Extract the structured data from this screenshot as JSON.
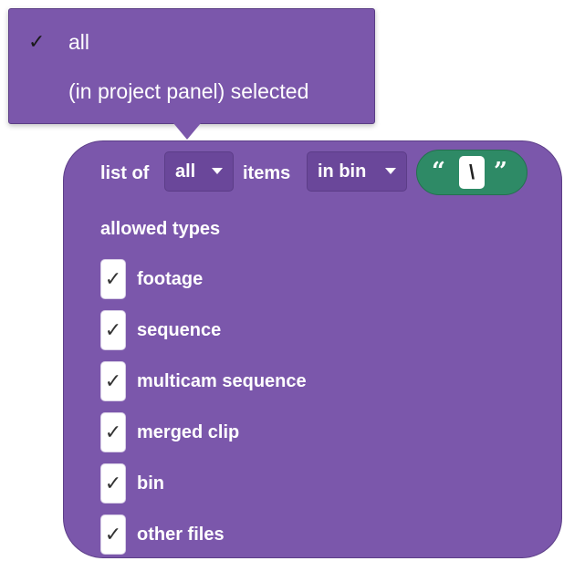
{
  "dropdown_menu": {
    "items": [
      {
        "label": "all",
        "checkmark": "✓",
        "selected": true
      },
      {
        "label": "(in project panel) selected",
        "checkmark": "",
        "selected": false
      }
    ]
  },
  "block": {
    "list_of_label": "list of",
    "scope_dropdown_value": "all",
    "items_label": "items",
    "location_dropdown_value": "in bin",
    "text_block": {
      "open_quote": "“",
      "value": "\\",
      "close_quote": "”"
    },
    "allowed_types_title": "allowed types",
    "checkboxes": [
      {
        "label": "footage",
        "checked": true,
        "mark": "✓"
      },
      {
        "label": "sequence",
        "checked": true,
        "mark": "✓"
      },
      {
        "label": "multicam sequence",
        "checked": true,
        "mark": "✓"
      },
      {
        "label": "merged clip",
        "checked": true,
        "mark": "✓"
      },
      {
        "label": "bin",
        "checked": true,
        "mark": "✓"
      },
      {
        "label": "other files",
        "checked": true,
        "mark": "✓"
      }
    ]
  },
  "colors": {
    "block_purple": "#7b57ab",
    "dropdown_field_purple": "#6a479a",
    "text_block_green": "#2e8a66",
    "text_white": "#ffffff"
  }
}
